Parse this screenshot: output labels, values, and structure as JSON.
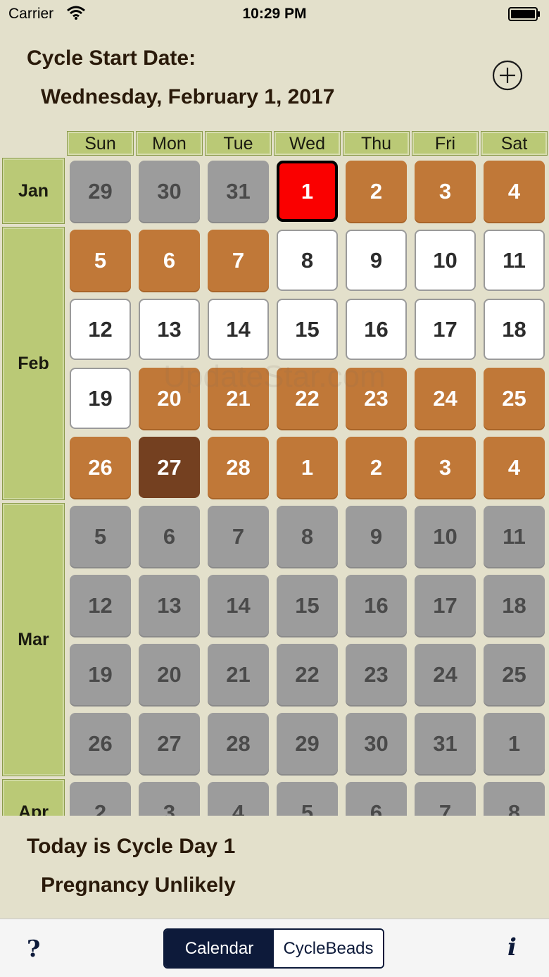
{
  "status_bar": {
    "carrier": "Carrier",
    "time": "10:29 PM"
  },
  "header": {
    "title": "Cycle Start Date:",
    "date": "Wednesday, February 1, 2017"
  },
  "weekdays": [
    "Sun",
    "Mon",
    "Tue",
    "Wed",
    "Thu",
    "Fri",
    "Sat"
  ],
  "months": [
    {
      "label": "Jan",
      "rows": 1
    },
    {
      "label": "Feb",
      "rows": 4
    },
    {
      "label": "Mar",
      "rows": 4
    },
    {
      "label": "Apr",
      "rows": 1
    }
  ],
  "calendar_rows": [
    [
      [
        "29",
        "gray"
      ],
      [
        "30",
        "gray"
      ],
      [
        "31",
        "gray"
      ],
      [
        "1",
        "red"
      ],
      [
        "2",
        "orange"
      ],
      [
        "3",
        "orange"
      ],
      [
        "4",
        "orange"
      ]
    ],
    [
      [
        "5",
        "orange"
      ],
      [
        "6",
        "orange"
      ],
      [
        "7",
        "orange"
      ],
      [
        "8",
        "white"
      ],
      [
        "9",
        "white"
      ],
      [
        "10",
        "white"
      ],
      [
        "11",
        "white"
      ]
    ],
    [
      [
        "12",
        "white"
      ],
      [
        "13",
        "white"
      ],
      [
        "14",
        "white"
      ],
      [
        "15",
        "white"
      ],
      [
        "16",
        "white"
      ],
      [
        "17",
        "white"
      ],
      [
        "18",
        "white"
      ]
    ],
    [
      [
        "19",
        "white"
      ],
      [
        "20",
        "orange"
      ],
      [
        "21",
        "orange"
      ],
      [
        "22",
        "orange"
      ],
      [
        "23",
        "orange"
      ],
      [
        "24",
        "orange"
      ],
      [
        "25",
        "orange"
      ]
    ],
    [
      [
        "26",
        "orange"
      ],
      [
        "27",
        "dark"
      ],
      [
        "28",
        "orange"
      ],
      [
        "1",
        "orange"
      ],
      [
        "2",
        "orange"
      ],
      [
        "3",
        "orange"
      ],
      [
        "4",
        "orange"
      ]
    ],
    [
      [
        "5",
        "gray"
      ],
      [
        "6",
        "gray"
      ],
      [
        "7",
        "gray"
      ],
      [
        "8",
        "gray"
      ],
      [
        "9",
        "gray"
      ],
      [
        "10",
        "gray"
      ],
      [
        "11",
        "gray"
      ]
    ],
    [
      [
        "12",
        "gray"
      ],
      [
        "13",
        "gray"
      ],
      [
        "14",
        "gray"
      ],
      [
        "15",
        "gray"
      ],
      [
        "16",
        "gray"
      ],
      [
        "17",
        "gray"
      ],
      [
        "18",
        "gray"
      ]
    ],
    [
      [
        "19",
        "gray"
      ],
      [
        "20",
        "gray"
      ],
      [
        "21",
        "gray"
      ],
      [
        "22",
        "gray"
      ],
      [
        "23",
        "gray"
      ],
      [
        "24",
        "gray"
      ],
      [
        "25",
        "gray"
      ]
    ],
    [
      [
        "26",
        "gray"
      ],
      [
        "27",
        "gray"
      ],
      [
        "28",
        "gray"
      ],
      [
        "29",
        "gray"
      ],
      [
        "30",
        "gray"
      ],
      [
        "31",
        "gray"
      ],
      [
        "1",
        "gray"
      ]
    ],
    [
      [
        "2",
        "gray"
      ],
      [
        "3",
        "gray"
      ],
      [
        "4",
        "gray"
      ],
      [
        "5",
        "gray"
      ],
      [
        "6",
        "gray"
      ],
      [
        "7",
        "gray"
      ],
      [
        "8",
        "gray"
      ]
    ]
  ],
  "watermark": "UpdateStar.com",
  "today": {
    "cycle_day": "Today is Cycle Day 1",
    "fertility": "Pregnancy Unlikely"
  },
  "tabbar": {
    "help": "?",
    "info": "i",
    "tabs": [
      "Calendar",
      "CycleBeads"
    ],
    "active_tab": 0
  },
  "colors": {
    "background": "#e3e0cb",
    "header_green": "#bac976",
    "fertile_white": "#ffffff",
    "period_red": "#fa0000",
    "cycle_orange": "#c07838",
    "today_brown": "#744020",
    "inactive_gray": "#9c9c9c",
    "navy": "#0d1a3a"
  }
}
